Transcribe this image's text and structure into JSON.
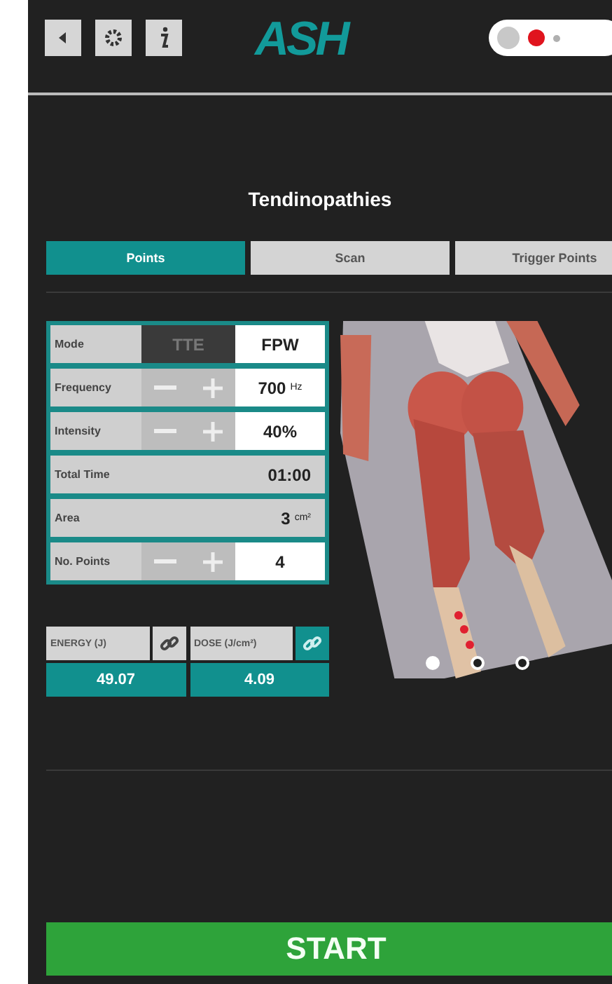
{
  "header": {
    "buttons": [
      {
        "kind": "back"
      },
      {
        "kind": "settings"
      },
      {
        "kind": "info"
      }
    ],
    "logo": "ASH",
    "status": {
      "dots": [
        {
          "color": "#c8c8c8"
        },
        {
          "color": "#e0141e"
        },
        {
          "color": "#b0b0b0"
        }
      ]
    }
  },
  "title": "Tendinopathies",
  "tabs": [
    {
      "label": "Points",
      "selected": true
    },
    {
      "label": "Scan",
      "selected": false
    },
    {
      "label": "Trigger Points",
      "selected": false
    }
  ],
  "params": [
    {
      "kind": "mode",
      "label": "Mode",
      "options": [
        {
          "label": "TTE",
          "selected": false
        },
        {
          "label": "FPW",
          "selected": true
        }
      ]
    },
    {
      "kind": "stepper",
      "label": "Frequency",
      "value": "700",
      "unit": "Hz"
    },
    {
      "kind": "stepper",
      "label": "Intensity",
      "value": "40%"
    },
    {
      "kind": "readonly",
      "label": "Total Time",
      "value": "01:00"
    },
    {
      "kind": "readonly",
      "label": "Area",
      "value": "3",
      "unit": "cm²"
    },
    {
      "kind": "stepper",
      "label": "No. Points",
      "value": "4"
    }
  ],
  "results": [
    {
      "label": "ENERGY (J)",
      "linked": false,
      "value": "49.07"
    },
    {
      "label": "DOSE (J/cm²)",
      "linked": true,
      "value": "4.09"
    }
  ],
  "carousel": {
    "pages": [
      {
        "selected": true
      },
      {
        "selected": false
      },
      {
        "selected": false
      }
    ]
  },
  "start_button": "START"
}
